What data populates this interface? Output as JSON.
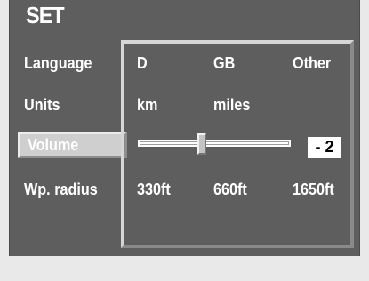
{
  "title": "SET",
  "menu": {
    "items": [
      {
        "label": "Language"
      },
      {
        "label": "Units"
      },
      {
        "label": "Volume"
      },
      {
        "label": "Wp. radius"
      }
    ],
    "selected": "Volume"
  },
  "options": {
    "language": [
      "D",
      "GB",
      "Other"
    ],
    "units": [
      "km",
      "miles"
    ],
    "volume": {
      "value_label": "- 2",
      "level_fraction": 0.42
    },
    "wp_radius": [
      "330ft",
      "660ft",
      "1650ft"
    ]
  },
  "colors": {
    "background": "#5e5e5e",
    "highlight": "#cfcfcf",
    "text": "#ffffff",
    "footer": "#e9e9e9"
  }
}
